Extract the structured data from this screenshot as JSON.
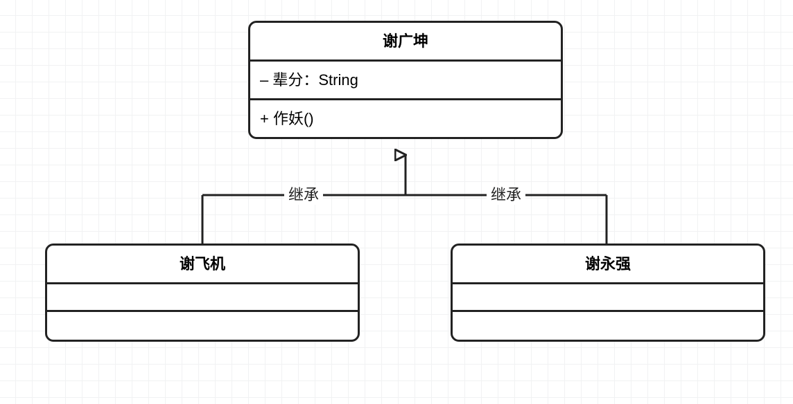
{
  "diagram": {
    "type": "uml-class",
    "parent": {
      "name": "谢广坤",
      "attributes": [
        "– 辈分：String"
      ],
      "methods": [
        "+ 作妖()"
      ]
    },
    "children": [
      {
        "name": "谢飞机",
        "relation_label": "继承"
      },
      {
        "name": "谢永强",
        "relation_label": "继承"
      }
    ]
  },
  "chart_data": {
    "type": "diagram",
    "nodes": [
      {
        "id": "parent",
        "name": "谢广坤",
        "attributes": [
          "- 辈分: String"
        ],
        "methods": [
          "+ 作妖()"
        ]
      },
      {
        "id": "childA",
        "name": "谢飞机",
        "attributes": [],
        "methods": []
      },
      {
        "id": "childB",
        "name": "谢永强",
        "attributes": [],
        "methods": []
      }
    ],
    "edges": [
      {
        "from": "childA",
        "to": "parent",
        "type": "inheritance",
        "label": "继承"
      },
      {
        "from": "childB",
        "to": "parent",
        "type": "inheritance",
        "label": "继承"
      }
    ]
  }
}
